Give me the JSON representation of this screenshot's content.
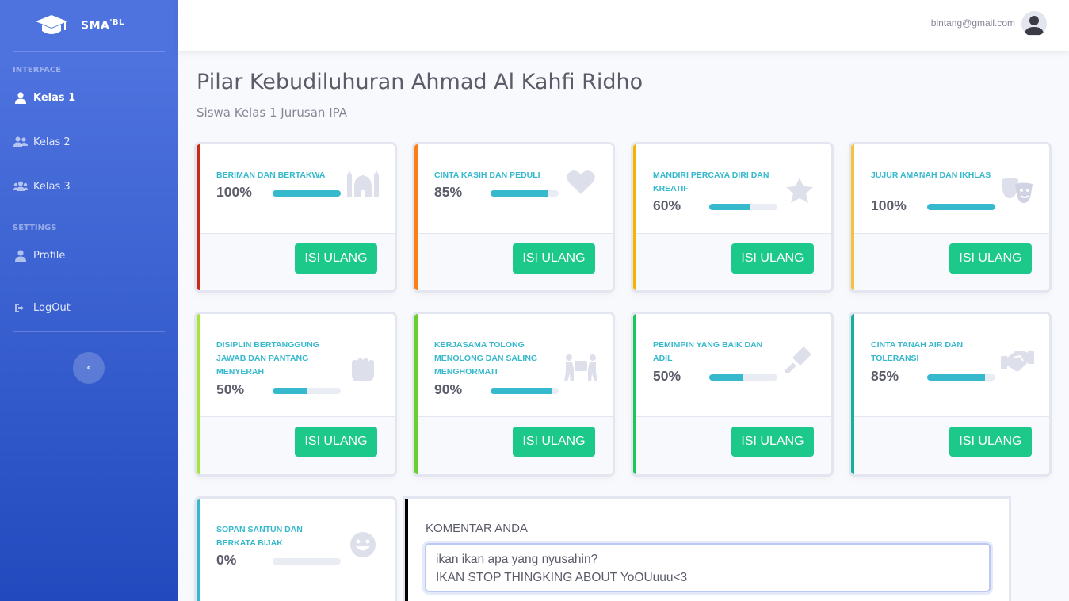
{
  "brand": {
    "name": "SMA",
    "sup": "'BL",
    "icon": "graduation-cap-icon"
  },
  "sidebar": {
    "heading_interface": "INTERFACE",
    "items": [
      {
        "label": "Kelas 1",
        "icon": "user-icon",
        "active": true
      },
      {
        "label": "Kelas 2",
        "icon": "users-icon",
        "active": false
      },
      {
        "label": "Kelas 3",
        "icon": "users-group-icon",
        "active": false
      }
    ],
    "heading_settings": "SETTINGS",
    "profile": {
      "label": "Profile",
      "icon": "user-icon"
    },
    "logout": {
      "label": "LogOut",
      "icon": "sign-out-icon"
    },
    "toggle": "‹"
  },
  "topbar": {
    "email": "bintang@gmail.com",
    "avatar_icon": "user-avatar-icon"
  },
  "page": {
    "title": "Pilar Kebudiluhuran Ahmad Al Kahfi Ridho",
    "subtitle": "Siswa Kelas 1 Jurusan IPA"
  },
  "cards": [
    {
      "label": "BERIMAN DAN BERTAKWA",
      "pct": "100%",
      "progress": 1.0,
      "color": "#e74a3b",
      "icon": "mosque-icon",
      "button": "ISI ULANG"
    },
    {
      "label": "CINTA KASIH DAN PEDULI",
      "pct": "85%",
      "progress": 0.85,
      "color": "#fd7e14",
      "icon": "heart-icon",
      "button": "ISI ULANG"
    },
    {
      "label": "MANDIRI PERCAYA DIRI DAN KREATIF",
      "pct": "60%",
      "progress": 0.6,
      "color": "#f6c23e",
      "icon": "star-icon",
      "button": "ISI ULANG"
    },
    {
      "label": "JUJUR AMANAH DAN IKHLAS",
      "pct": "100%",
      "progress": 1.0,
      "color": "#f6c23e",
      "icon": "theater-masks-icon",
      "button": "ISI ULANG"
    },
    {
      "label": "DISIPLIN BERTANGGUNG JAWAB DAN PANTANG MENYERAH",
      "pct": "50%",
      "progress": 0.5,
      "color": "#a3e635",
      "icon": "fist-icon",
      "button": "ISI ULANG"
    },
    {
      "label": "KERJASAMA TOLONG MENOLONG DAN SALING MENGHORMATI",
      "pct": "90%",
      "progress": 0.9,
      "color": "#66d12a",
      "icon": "people-carry-icon",
      "button": "ISI ULANG"
    },
    {
      "label": "PEMIMPIN YANG BAIK DAN ADIL",
      "pct": "50%",
      "progress": 0.5,
      "color": "#1cc88a",
      "icon": "gavel-icon",
      "button": "ISI ULANG"
    },
    {
      "label": "CINTA TANAH AIR DAN TOLERANSI",
      "pct": "85%",
      "progress": 0.85,
      "color": "#20b2aa",
      "icon": "handshake-icon",
      "button": "ISI ULANG"
    },
    {
      "label": "SOPAN SANTUN DAN BERKATA BIJAK",
      "pct": "0%",
      "progress": 0.0,
      "color": "#36b9cc",
      "icon": "smile-icon",
      "button": ""
    }
  ],
  "comment": {
    "title": "KOMENTAR ANDA",
    "value": "ikan ikan apa yang nyusahin?\nIKAN STOP THINGKING ABOUT YoOUuuu<3"
  }
}
